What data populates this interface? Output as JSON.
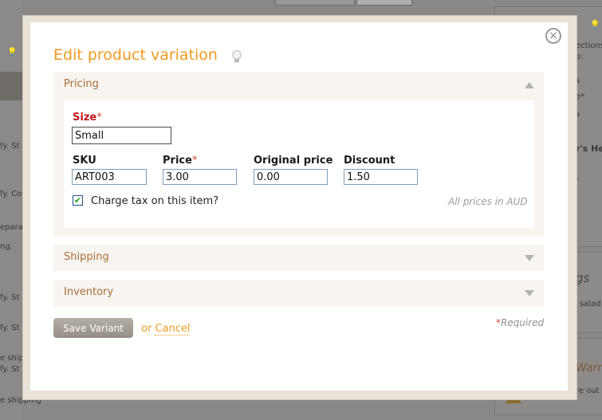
{
  "background": {
    "left_fragments": [
      "fy. St",
      "fy. Co",
      "epara",
      "ng.",
      "fy. St",
      "fy. St",
      "e ship",
      "fy. St",
      "e shipping"
    ],
    "right_fragments": [
      "ections",
      "o:",
      "s",
      "e*",
      "s",
      "r's Help",
      "r",
      "gs",
      "salad",
      "Warn",
      "re out"
    ]
  },
  "modal": {
    "title": "Edit product variation",
    "close_symbol": "×"
  },
  "pricing": {
    "label": "Pricing",
    "size_label": "Size",
    "size_value": "Small",
    "sku_label": "SKU",
    "sku_value": "ART003",
    "price_label": "Price",
    "price_value": "3.00",
    "original_price_label": "Original price",
    "original_price_value": "0.00",
    "discount_label": "Discount",
    "discount_value": "1.50",
    "tax_label": "Charge tax on this item?",
    "tax_checked": true,
    "currency_note": "All prices in AUD",
    "required_star": "*"
  },
  "sections": {
    "shipping": "Shipping",
    "inventory": "Inventory"
  },
  "actions": {
    "save_label": "Save Variant",
    "or_text": "or ",
    "cancel_label": "Cancel",
    "required_note": "Required",
    "required_star": "*"
  },
  "colors": {
    "accent": "#ef9a1f",
    "section_label": "#a56f3a",
    "required": "#d04a3a"
  }
}
